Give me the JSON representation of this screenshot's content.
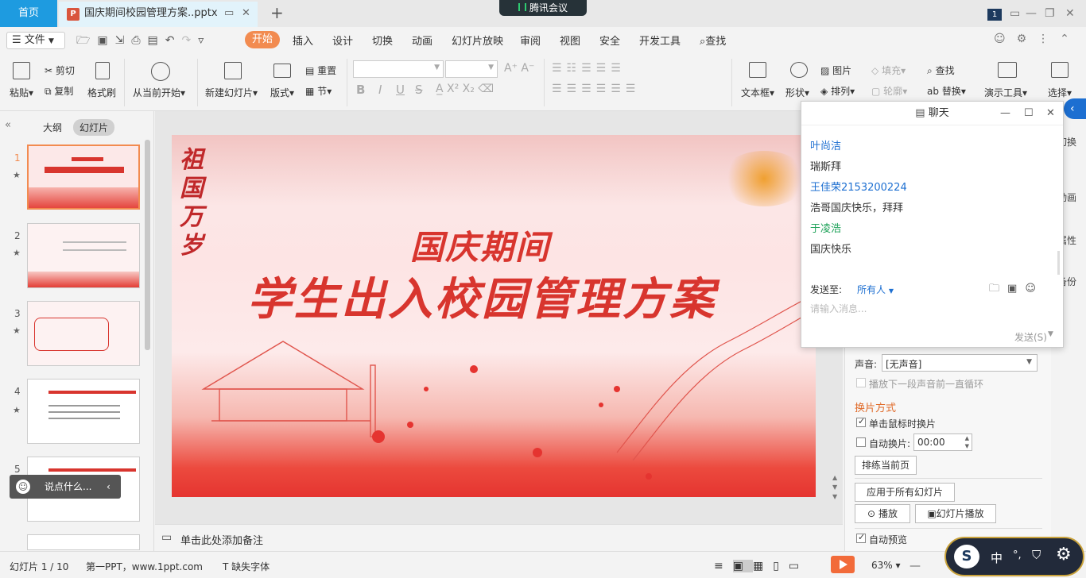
{
  "titlebar": {
    "home_tab": "首页",
    "doc_tab": "国庆期间校园管理方案..pptx",
    "new_tab": "+",
    "meeting_label": "腾讯会议",
    "badge": "1"
  },
  "menubar": {
    "file": "文件",
    "tabs": [
      "开始",
      "插入",
      "设计",
      "切换",
      "动画",
      "幻灯片放映",
      "审阅",
      "视图",
      "安全",
      "开发工具"
    ],
    "search": "查找"
  },
  "ribbon": {
    "paste": "粘贴",
    "cut": "剪切",
    "copy": "复制",
    "format_painter": "格式刷",
    "from_current": "从当前开始",
    "new_slide": "新建幻灯片",
    "layout": "版式",
    "reset": "重置",
    "section": "节",
    "textbox": "文本框",
    "shape": "形状",
    "picture": "图片",
    "arrange": "排列",
    "fill": "填充",
    "outline": "轮廓",
    "find": "查找",
    "replace": "替换",
    "presenter_tools": "演示工具",
    "select": "选择",
    "bold": "B",
    "italic": "I",
    "underline": "U",
    "strike": "S"
  },
  "leftpanel": {
    "tab_outline": "大纲",
    "tab_slides": "幻灯片",
    "slide_numbers": [
      "1",
      "2",
      "3",
      "4",
      "5"
    ],
    "chatbar_text": "说点什么..."
  },
  "slide": {
    "title_line1": "国庆期间",
    "title_line2": "学生出入校园管理方案",
    "calligraphy": "祖国万岁"
  },
  "notes": {
    "placeholder": "单击此处添加备注"
  },
  "chat": {
    "title": "聊天",
    "messages": [
      {
        "text": "叶尚洁",
        "kind": "name-blue"
      },
      {
        "text": "瑞斯拜",
        "kind": "text"
      },
      {
        "text": "王佳荣2153200224",
        "kind": "name-blue"
      },
      {
        "text": "浩哥国庆快乐，拜拜",
        "kind": "text"
      },
      {
        "text": "于凌浩",
        "kind": "name-green"
      },
      {
        "text": "国庆快乐",
        "kind": "text"
      }
    ],
    "send_to_label": "发送至:",
    "send_to_value": "所有人",
    "input_placeholder": "请输入消息...",
    "send_button": "发送(S)"
  },
  "rightpanel": {
    "sound_label": "声音:",
    "sound_value": "[无声音]",
    "loop_label": "播放下一段声音前一直循环",
    "section_title": "换片方式",
    "on_click": "单击鼠标时换片",
    "auto": "自动换片:",
    "auto_time": "00:00",
    "rehearse": "排练当前页",
    "apply_all": "应用于所有幻灯片",
    "play": "播放",
    "slideshow": "幻灯片播放",
    "autopreview": "自动预览"
  },
  "sidetabs": [
    "切换",
    "动画",
    "属性",
    "备份"
  ],
  "statusbar": {
    "slide_counter": "幻灯片 1 / 10",
    "template": "第一PPT，www.1ppt.com",
    "missing_font": "缺失字体",
    "zoom": "63%",
    "ime_char": "中"
  }
}
